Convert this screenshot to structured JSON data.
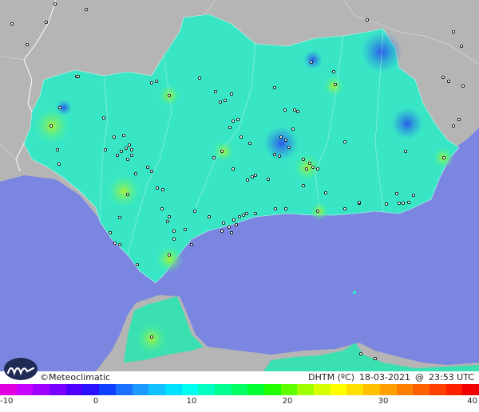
{
  "brand": {
    "symbol": "©",
    "name": "Meteoclimatic"
  },
  "info": {
    "variable": "DHTM (ºC)",
    "date": "18-03-2021",
    "at": "@",
    "time": "23:53 UTC"
  },
  "scale": {
    "ticks": [
      "-10",
      "0",
      "10",
      "20",
      "30",
      "40"
    ],
    "colors": [
      "#e000e0",
      "#c800ff",
      "#a000ff",
      "#7a00ff",
      "#5000ff",
      "#2b10ff",
      "#1040ff",
      "#1c70ff",
      "#1c98ff",
      "#10c0ff",
      "#00e0ff",
      "#00fff0",
      "#00ffc0",
      "#00ff90",
      "#00ff60",
      "#00ff30",
      "#20ff00",
      "#60ff00",
      "#a0ff00",
      "#d8ff00",
      "#ffff00",
      "#ffe000",
      "#ffc000",
      "#ffa000",
      "#ff8000",
      "#ff6000",
      "#ff4000",
      "#ff2000",
      "#f00000"
    ]
  },
  "colors": {
    "sea": "#7b86e0",
    "land": "#b8b8b8",
    "region": "#33e0c4",
    "stations": "#000000"
  }
}
